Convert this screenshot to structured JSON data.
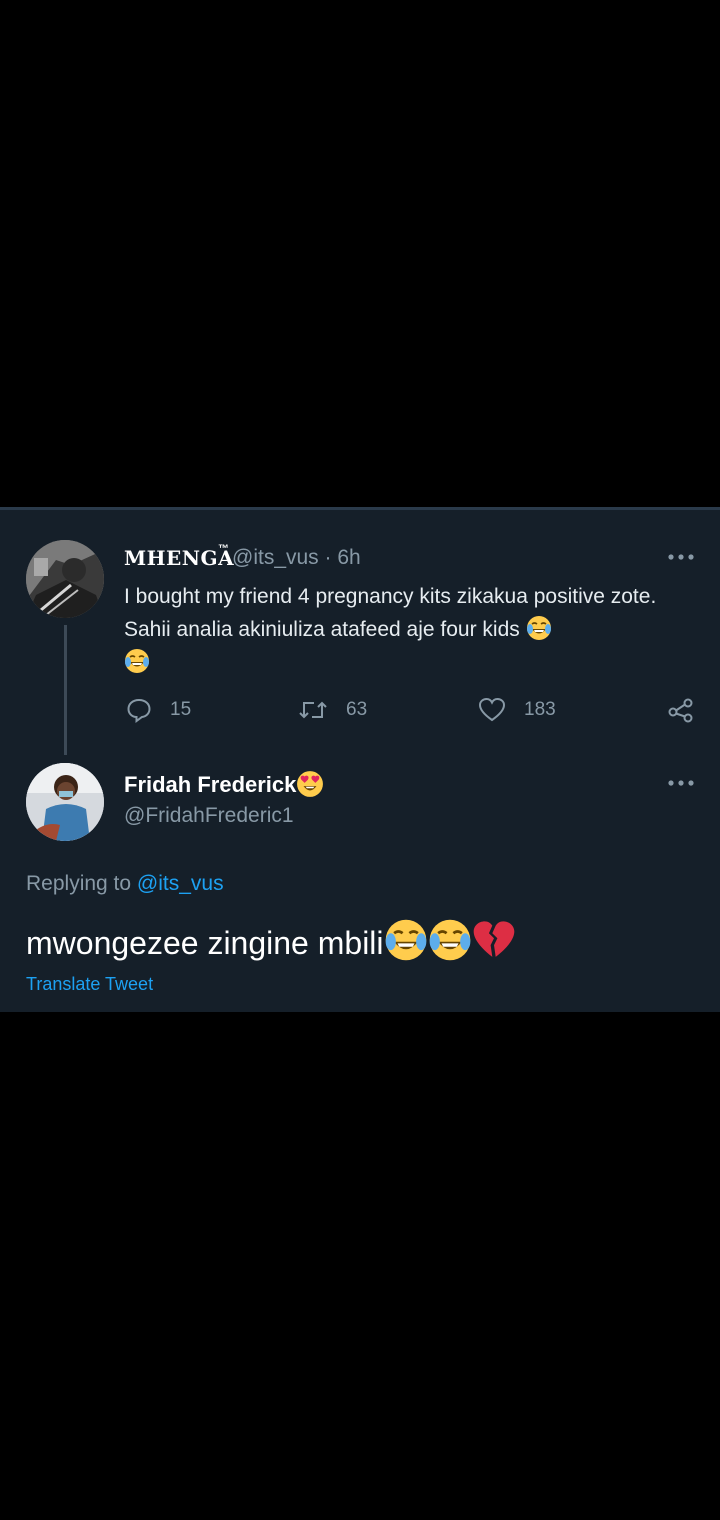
{
  "tweet": {
    "author_name": "MHENGA",
    "author_tm": "™",
    "handle_time": "@its_vus · 6h",
    "text": "I bought my friend 4 pregnancy kits zikakua positive zote. Sahii analia akiniuliza atafeed aje four kids",
    "emoji": "face-with-tears-of-joy",
    "actions": {
      "reply_count": "15",
      "retweet_count": "63",
      "like_count": "183"
    }
  },
  "reply": {
    "author_name": "Fridah Frederick",
    "name_emoji": "smiling-face-with-heart-eyes",
    "handle": "@FridahFrederic1",
    "replying_prefix": "Replying to ",
    "replying_to": "@its_vus",
    "text": "mwongezee zingine mbili",
    "emojis": [
      "face-with-tears-of-joy",
      "face-with-tears-of-joy",
      "broken-heart"
    ],
    "translate_label": "Translate Tweet"
  },
  "colors": {
    "card_background": "#151f29",
    "page_background": "#000000",
    "link": "#1da1f2",
    "secondary_text": "#8899a6"
  }
}
